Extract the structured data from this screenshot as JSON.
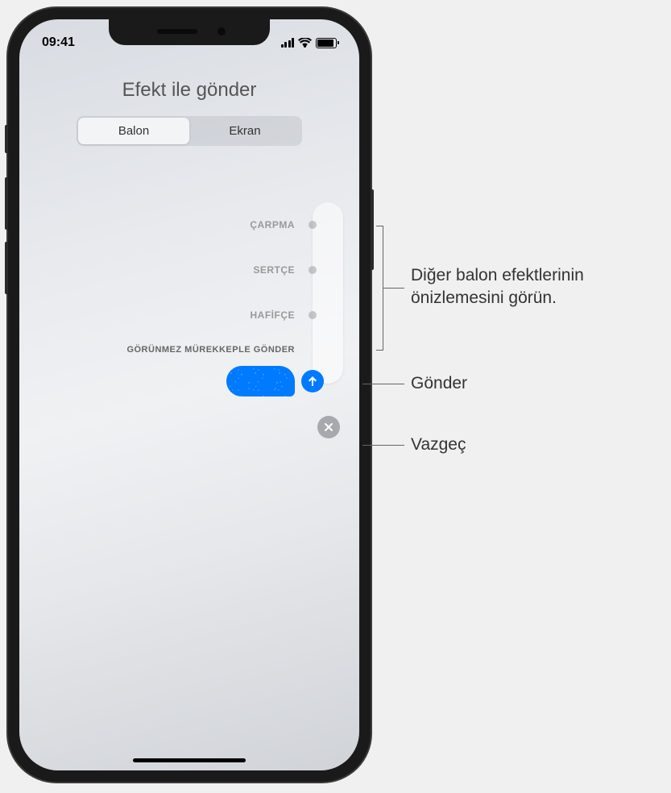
{
  "status_bar": {
    "time": "09:41"
  },
  "header": {
    "title": "Efekt ile gönder"
  },
  "tabs": {
    "balloon": "Balon",
    "screen": "Ekran"
  },
  "effects": {
    "slam": "ÇARPMA",
    "loud": "SERTÇE",
    "gentle": "HAFİFÇE",
    "invisible_ink": "GÖRÜNMEZ MÜREKKEPLE GÖNDER"
  },
  "callouts": {
    "preview": "Diğer balon efektlerinin önizlemesini görün.",
    "send": "Gönder",
    "cancel": "Vazgeç"
  }
}
